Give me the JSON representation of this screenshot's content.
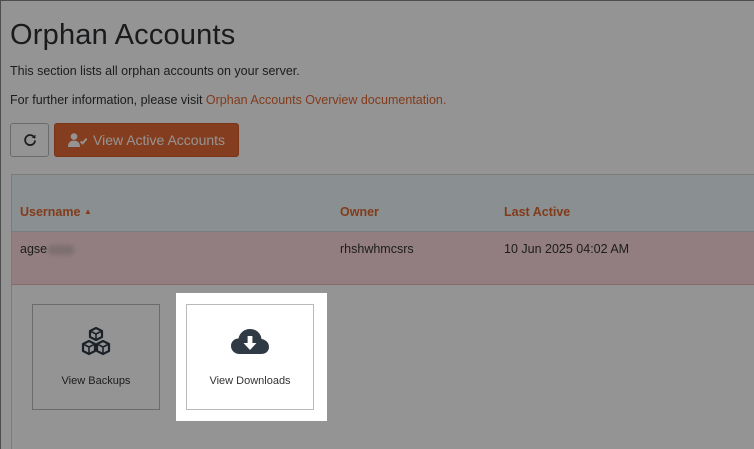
{
  "page": {
    "title": "Orphan Accounts",
    "description": "This section lists all orphan accounts on your server.",
    "info_prefix": "For further information, please visit ",
    "info_link": "Orphan Accounts Overview documentation."
  },
  "toolbar": {
    "refresh_icon": "refresh-icon",
    "view_active_label": "View Active Accounts",
    "view_active_icon": "user-check-icon"
  },
  "table": {
    "columns": {
      "username": "Username",
      "owner": "Owner",
      "last_active": "Last Active"
    },
    "sort_indicator": "▲",
    "rows": [
      {
        "username": "agse",
        "owner": "rhshwhmcsrs",
        "last_active": "10 Jun 2025 04:02 AM"
      }
    ]
  },
  "actions": {
    "view_backups": "View Backups",
    "view_downloads": "View Downloads",
    "backups_icon": "boxes-icon",
    "downloads_icon": "cloud-download-icon"
  },
  "colors": {
    "accent": "#e46a34",
    "row_highlight": "#fcd9dd",
    "header_bg": "#eef6fa"
  }
}
